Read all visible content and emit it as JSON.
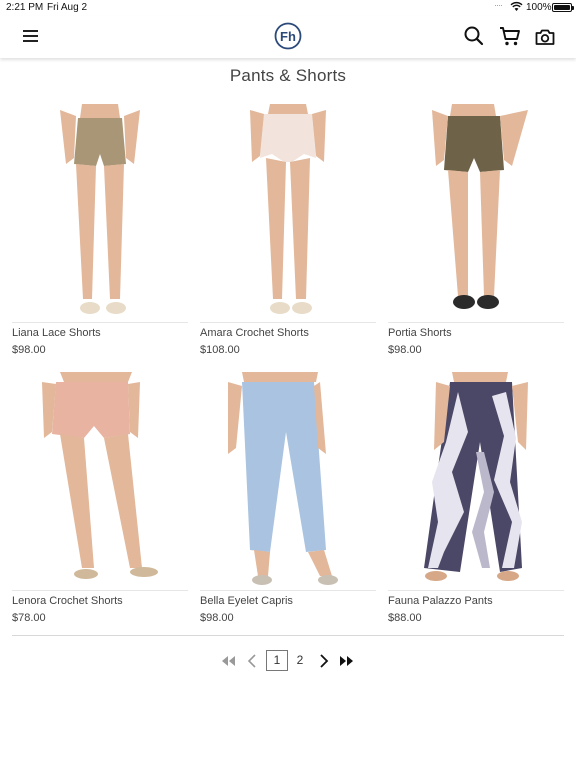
{
  "status_bar": {
    "time": "2:21 PM",
    "date": "Fri Aug 2",
    "battery": "100%"
  },
  "nav": {
    "logo_text": "Fh",
    "icons": [
      "menu-icon",
      "search-icon",
      "cart-icon",
      "camera-icon"
    ]
  },
  "page": {
    "title": "Pants & Shorts"
  },
  "products": [
    {
      "name": "Liana Lace Shorts",
      "price": "$98.00",
      "color": "#a89676"
    },
    {
      "name": "Amara Crochet Shorts",
      "price": "$108.00",
      "color": "#f2e4dc"
    },
    {
      "name": "Portia Shorts",
      "price": "$98.00",
      "color": "#6e6248"
    },
    {
      "name": "Lenora Crochet Shorts",
      "price": "$78.00",
      "color": "#e8b3a0"
    },
    {
      "name": "Bella Eyelet Capris",
      "price": "$98.00",
      "color": "#a9c3e0"
    },
    {
      "name": "Fauna Palazzo Pants",
      "price": "$88.00",
      "color": "#4b4766"
    }
  ],
  "pagination": {
    "current": "1",
    "next_page": "2"
  },
  "colors": {
    "brand": "#2b4a7a",
    "skin": "#e2b79a"
  }
}
